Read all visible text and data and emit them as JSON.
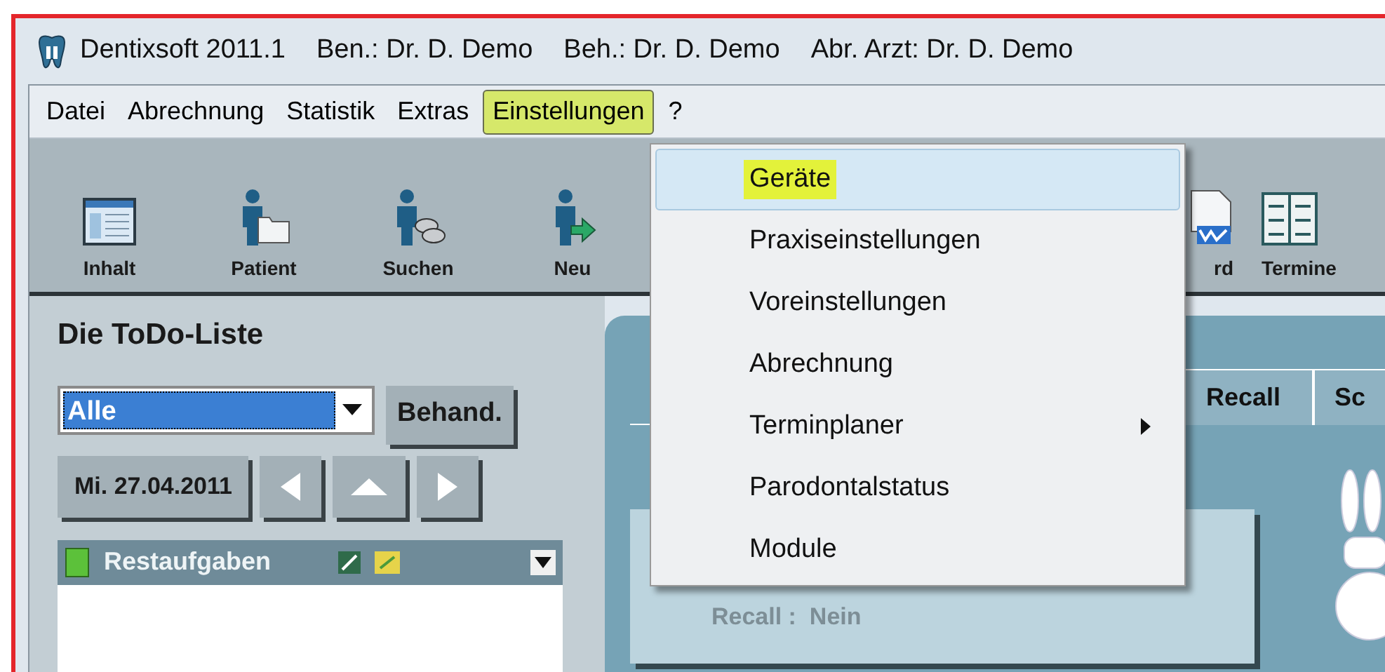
{
  "window": {
    "title": "Dentixsoft 2011.1",
    "user": "Ben.: Dr. D. Demo",
    "treating": "Beh.: Dr. D. Demo",
    "billing": "Abr. Arzt: Dr. D. Demo"
  },
  "menu_bar": [
    {
      "label": "Datei",
      "selected": false
    },
    {
      "label": "Abrechnung",
      "selected": false
    },
    {
      "label": "Statistik",
      "selected": false
    },
    {
      "label": "Extras",
      "selected": false
    },
    {
      "label": "Einstellungen",
      "selected": true
    },
    {
      "label": "?",
      "selected": false
    }
  ],
  "toolbar": [
    {
      "label": "Inhalt",
      "kind": "contents"
    },
    {
      "label": "Patient",
      "kind": "patient"
    },
    {
      "label": "Suchen",
      "kind": "search"
    },
    {
      "label": "Neu",
      "kind": "new"
    },
    {
      "label": "rd",
      "kind": "word"
    },
    {
      "label": "Termine",
      "kind": "calendar"
    }
  ],
  "dropdown": [
    {
      "label": "Geräte",
      "selected": true,
      "submenu": false
    },
    {
      "label": "Praxiseinstellungen",
      "selected": false,
      "submenu": false
    },
    {
      "label": "Voreinstellungen",
      "selected": false,
      "submenu": false
    },
    {
      "label": "Abrechnung",
      "selected": false,
      "submenu": false
    },
    {
      "label": "Terminplaner",
      "selected": false,
      "submenu": true
    },
    {
      "label": "Parodontalstatus",
      "selected": false,
      "submenu": false
    },
    {
      "label": "Module",
      "selected": false,
      "submenu": false
    }
  ],
  "todo": {
    "title": "Die ToDo-Liste",
    "filter": "Alle",
    "treat_button": "Behand.",
    "date": "Mi. 27.04.2011",
    "section": "Restaufgaben"
  },
  "tabs": [
    {
      "label": "Recall"
    },
    {
      "label": "Sc"
    }
  ],
  "recall_label": "Recall :  Nein"
}
